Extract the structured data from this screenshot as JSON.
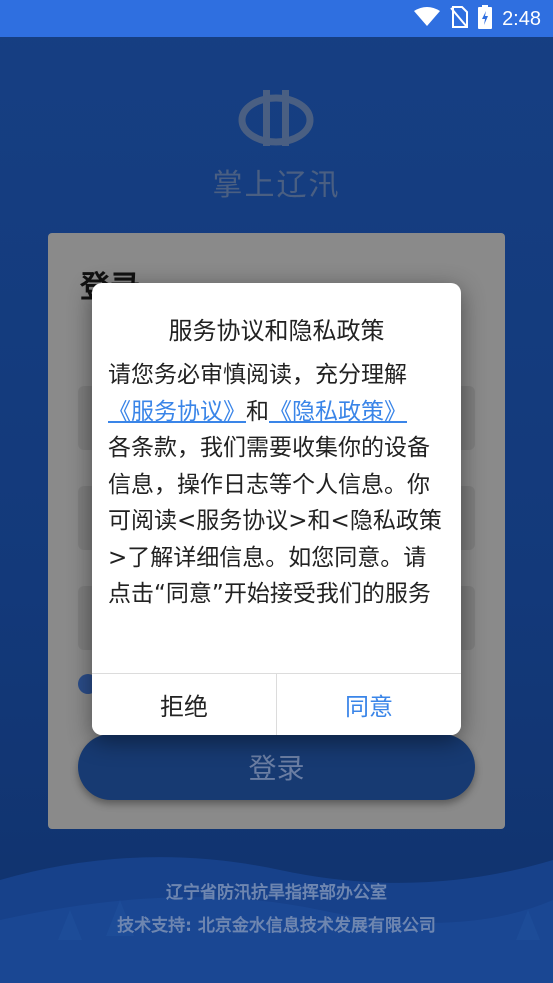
{
  "status_bar": {
    "time": "2:48",
    "icons": [
      "wifi-icon",
      "no-sim-icon",
      "battery-charging-icon"
    ]
  },
  "app": {
    "name": "掌上辽汛",
    "logo_icon": "river-logo-icon"
  },
  "login_card": {
    "title": "登录",
    "login_button": "登录"
  },
  "dialog": {
    "title": "服务协议和隐私政策",
    "body_intro": "请您务必审慎阅读，充分理解",
    "service_link": "《服务协议》",
    "and_text": "和",
    "privacy_link": "《隐私政策》",
    "body_rest": "各条款，我们需要收集你的设备信息，操作日志等个人信息。你可阅读<服务协议>和<隐私政策>了解详细信息。如您同意。请点击“同意”开始接受我们的服务",
    "reject_label": "拒绝",
    "agree_label": "同意"
  },
  "footer": {
    "org": "辽宁省防汛抗旱指挥部办公室",
    "support": "技术支持: 北京金水信息技术发展有限公司"
  },
  "colors": {
    "status_bar": "#2f6fe0",
    "background": "#163f83",
    "link": "#3a85e8",
    "agree": "#3a85e8"
  }
}
